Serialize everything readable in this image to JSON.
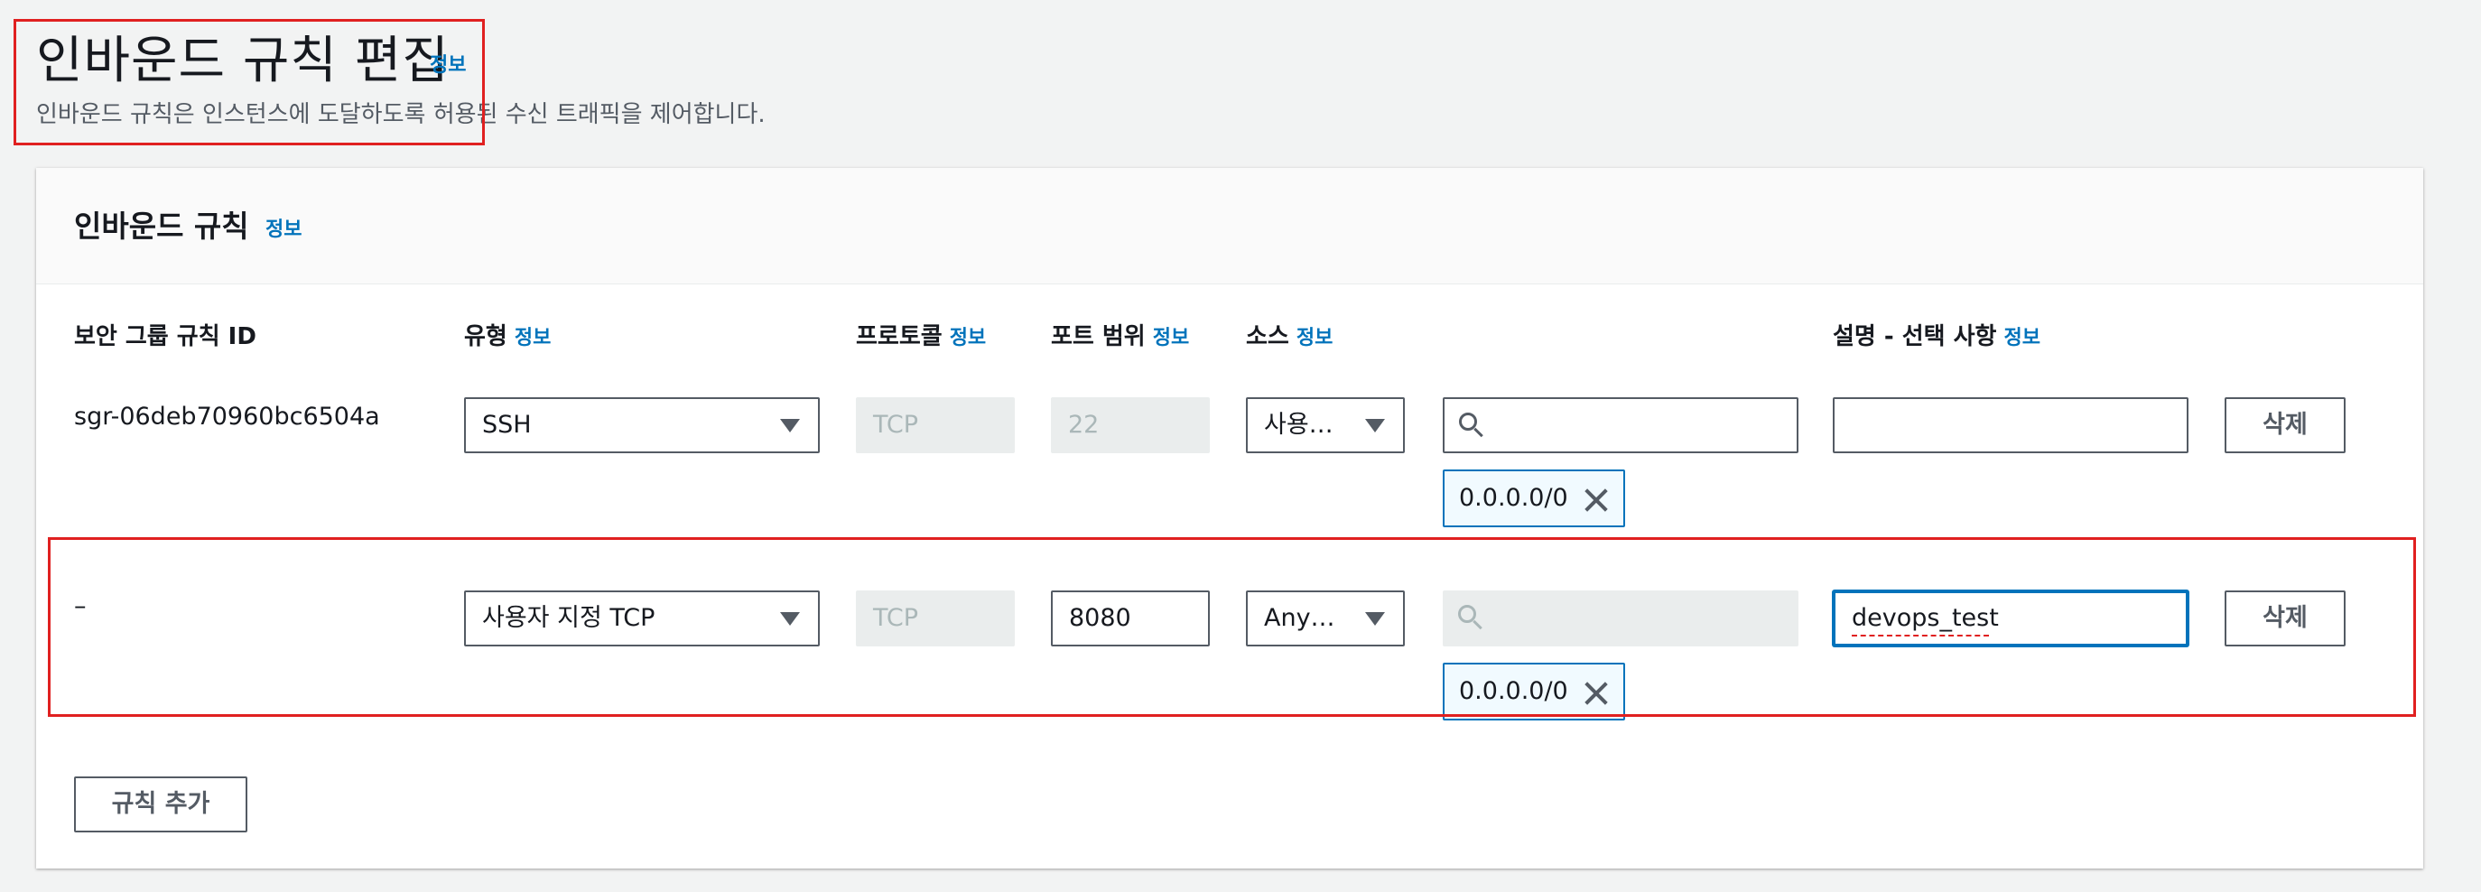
{
  "page": {
    "title": "인바운드 규칙 편집",
    "title_info": "정보",
    "subtitle": "인바운드 규칙은 인스턴스에 도달하도록 허용된 수신 트래픽을 제어합니다."
  },
  "panel": {
    "title": "인바운드 규칙",
    "info": "정보",
    "columns": {
      "rule_id": "보안 그룹 규칙 ID",
      "type": "유형",
      "protocol": "프로토콜",
      "port_range": "포트 범위",
      "source": "소스",
      "description": "설명 - 선택 사항",
      "info": "정보"
    },
    "rows": [
      {
        "rule_id": "sgr-06deb70960bc6504a",
        "type": "SSH",
        "protocol": "TCP",
        "port": "22",
        "source_type": "사용…",
        "cidr": "0.0.0.0/0",
        "description": "",
        "delete": "삭제"
      },
      {
        "rule_id": "–",
        "type": "사용자 지정 TCP",
        "protocol": "TCP",
        "port": "8080",
        "source_type": "Any…",
        "cidr": "0.0.0.0/0",
        "description": "devops_test",
        "delete": "삭제"
      }
    ],
    "add_rule": "규칙 추가"
  },
  "colors": {
    "accent": "#0073bb",
    "highlight": "#e02020",
    "background": "#f2f3f3"
  }
}
